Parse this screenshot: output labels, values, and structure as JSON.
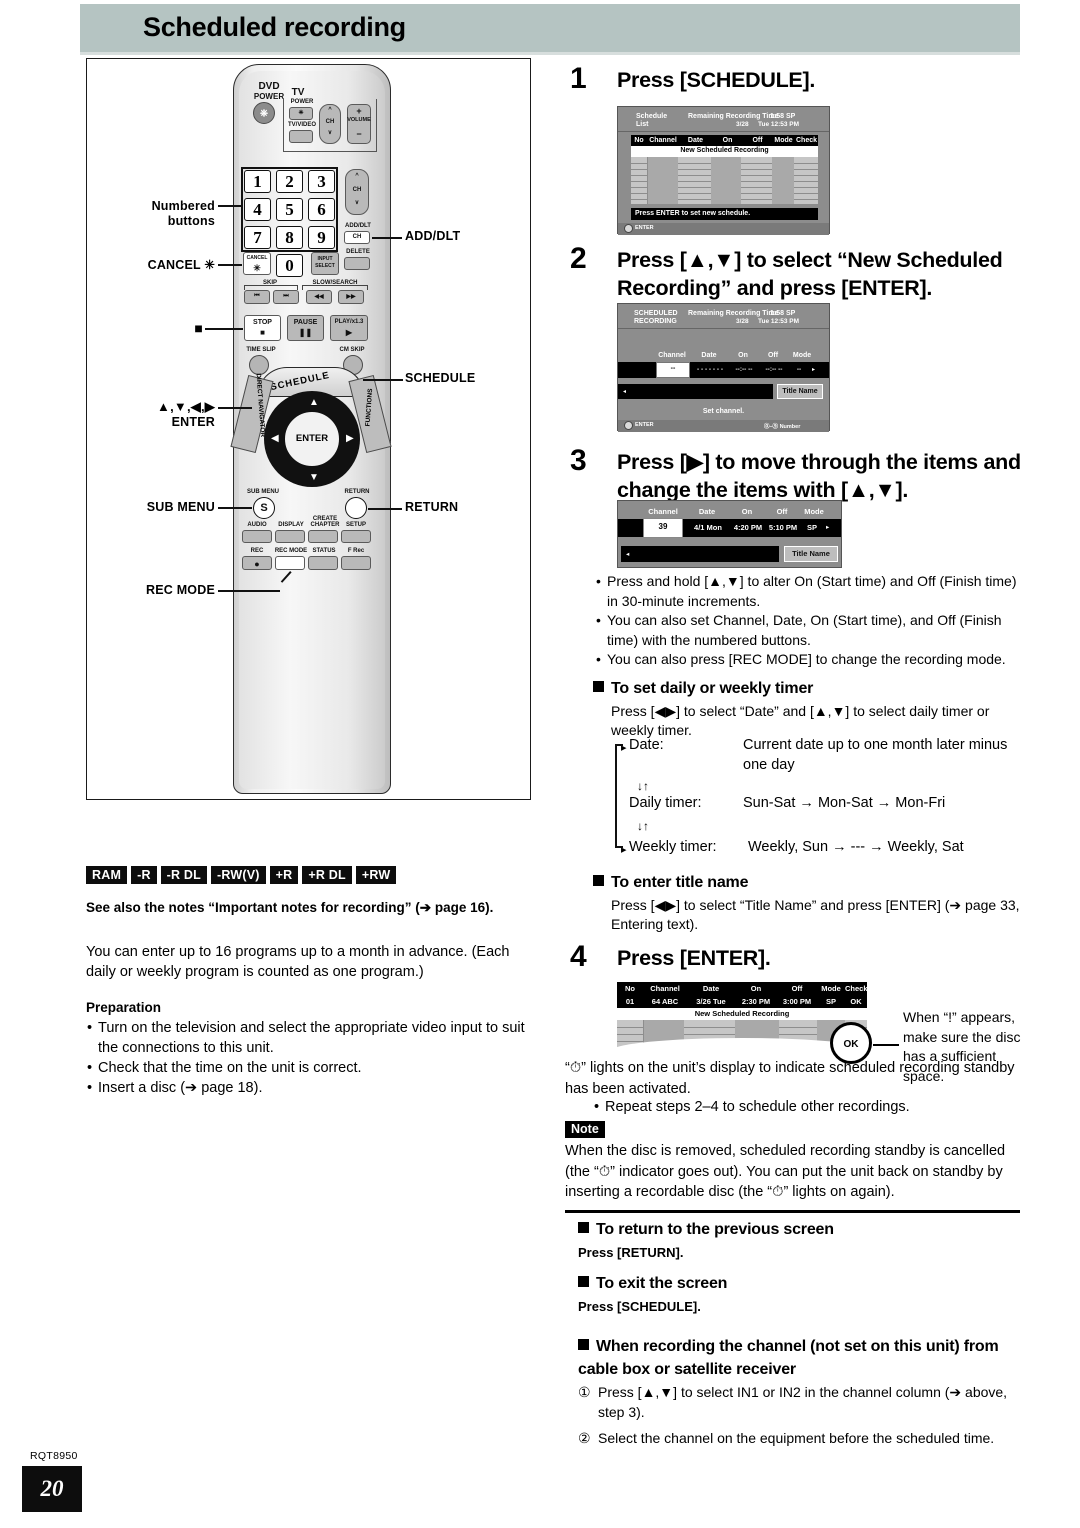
{
  "header": {
    "title": "Scheduled recording"
  },
  "remote": {
    "labels": {
      "numbered_buttons": "Numbered\nbuttons",
      "numbered_buttons_l1": "Numbered",
      "numbered_buttons_l2": "buttons",
      "cancel": "CANCEL ✳",
      "stop_square": "■",
      "arrows_enter_l1": "▲,▼,◀,▶",
      "arrows_enter_l2": "ENTER",
      "sub_menu": "SUB MENU",
      "rec_mode": "REC MODE",
      "add_dlt": "ADD/DLT",
      "schedule": "SCHEDULE",
      "return": "RETURN"
    },
    "buttons": {
      "dvd_power_l1": "DVD",
      "dvd_power_l2": "POWER",
      "tv": "TV",
      "tv_power": "POWER",
      "tv_video": "TV/VIDEO",
      "ch": "CH",
      "volume": "VOLUME",
      "vol_plus": "+",
      "vol_minus": "−",
      "add_dlt_small": "ADD/DLT",
      "ch_small": "CH",
      "delete": "DELETE",
      "cancel_small": "CANCEL",
      "cancel_star": "✳",
      "input_select_l1": "INPUT",
      "input_select_l2": "SELECT",
      "skip": "SKIP",
      "slow_search": "SLOW/SEARCH",
      "skip_back": "⏮",
      "skip_fwd": "⏭",
      "search_back": "◀◀",
      "search_fwd": "▶▶",
      "stop": "STOP",
      "pause": "PAUSE",
      "play": "PLAY/x1.3",
      "time_slip": "TIME SLIP",
      "cm_skip": "CM SKIP",
      "schedule_cap": "SCHEDULE",
      "direct_navigator": "DIRECT NAVIGATOR",
      "functions": "FUNCTIONS",
      "enter": "ENTER",
      "sub_menu_s": "S",
      "sub_menu_lbl": "SUB MENU",
      "return_lbl": "RETURN",
      "audio": "AUDIO",
      "display": "DISPLAY",
      "create_chapter_l1": "CREATE",
      "create_chapter_l2": "CHAPTER",
      "setup": "SETUP",
      "rec": "REC",
      "rec_mode": "REC MODE",
      "status": "STATUS",
      "f_rec": "F Rec",
      "keys": [
        "1",
        "2",
        "3",
        "4",
        "5",
        "6",
        "7",
        "8",
        "9",
        "0"
      ]
    }
  },
  "disc_badges": [
    "RAM",
    "-R",
    "-R DL",
    "-RW(V)",
    "+R",
    "+R DL",
    "+RW"
  ],
  "see_also": "See also the notes “Important notes for recording” (➔ page 16).",
  "intro": "You can enter up to 16 programs up to a month in advance. (Each daily or weekly program is counted as one program.)",
  "preparation": {
    "title": "Preparation",
    "items": [
      "Turn on the television and select the appropriate video input to suit the connections to this unit.",
      "Check that the time on the unit is correct.",
      "Insert a disc (➔ page 18)."
    ]
  },
  "steps": {
    "s1": {
      "num": "1",
      "text": "Press [SCHEDULE]."
    },
    "s2": {
      "num": "2",
      "text": "Press [▲,▼] to select “New Scheduled Recording” and press [ENTER]."
    },
    "s3": {
      "num": "3",
      "text": "Press [▶] to move through the items and change the items with [▲,▼]."
    },
    "s4": {
      "num": "4",
      "text": "Press [ENTER]."
    }
  },
  "osd1": {
    "title_l1": "Schedule",
    "title_l2": "List",
    "remaining": "Remaining Recording Time",
    "remaining_val": "1:58 SP",
    "datetime_date": "3/28",
    "datetime_time": "Tue 12:53 PM",
    "columns": [
      "No",
      "Channel",
      "Date",
      "On",
      "Off",
      "Mode",
      "Check"
    ],
    "new_row": "New Scheduled Recording",
    "message": "Press ENTER to set new schedule.",
    "enter_label": "ENTER"
  },
  "osd2": {
    "title_l1": "SCHEDULED",
    "title_l2": "RECORDING",
    "remaining": "Remaining Recording Time",
    "remaining_val": "1:58 SP",
    "datetime_date": "3/28",
    "datetime_time": "Tue 12:53 PM",
    "columns": [
      "Channel",
      "Date",
      "On",
      "Off",
      "Mode"
    ],
    "values": [
      "--",
      "- - - - - - -",
      "--:-- --",
      "--:-- --",
      "--"
    ],
    "arrow": "▸",
    "title_name_btn": "Title Name",
    "left_arrow": "◂",
    "message": "Set channel.",
    "enter_label": "ENTER",
    "number_label": "⓪–⑨  Number"
  },
  "osd3": {
    "columns": [
      "Channel",
      "Date",
      "On",
      "Off",
      "Mode"
    ],
    "values": [
      "39",
      "4/1 Mon",
      "4:20 PM",
      "5:10 PM",
      "SP"
    ],
    "arrow": "▸",
    "title_name_btn": "Title Name",
    "left_arrow": "◂"
  },
  "osd4": {
    "columns": [
      "No",
      "Channel",
      "Date",
      "On",
      "Off",
      "Mode",
      "Check"
    ],
    "row": [
      "01",
      "64 ABC",
      "3/26 Tue",
      "2:30 PM",
      "3:00 PM",
      "SP",
      "OK"
    ],
    "new_row": "New Scheduled Recording",
    "ok_badge": "OK",
    "callout_text": "When “!” appears, make sure the disc has a sufficient space."
  },
  "step3_bullets": [
    "Press and hold [▲,▼] to alter On (Start time) and Off (Finish time) in 30-minute increments.",
    "You can also set Channel, Date, On (Start time), and Off (Finish time) with the numbered buttons.",
    "You can also press [REC MODE] to change the recording mode."
  ],
  "daily_weekly": {
    "heading": "To set daily or weekly timer",
    "intro": "Press [◀▶] to select “Date” and [▲,▼] to select daily timer or weekly timer.",
    "rows": [
      {
        "label": "Date:",
        "value": "Current date up to one month later minus one day"
      },
      {
        "label": "Daily timer:",
        "value": "Sun-Sat → Mon-Sat → Mon-Fri"
      },
      {
        "label": "Weekly timer:",
        "value": "Weekly, Sun → --- → Weekly, Sat"
      }
    ],
    "updown": "↓↑"
  },
  "title_name": {
    "heading": "To enter title name",
    "body": "Press [◀▶] to select “Title Name” and press [ENTER] (➔ page 33, Entering text)."
  },
  "after_step4": {
    "line1": "“⏱” lights on the unit’s display to indicate scheduled recording standby has been activated.",
    "bullet": "Repeat steps 2–4 to schedule other recordings."
  },
  "note": {
    "tag": "Note",
    "body": "When the disc is removed, scheduled recording standby is cancelled (the “⏱” indicator goes out). You can put the unit back on standby by inserting a recordable disc (the “⏱” lights on again)."
  },
  "return_section": {
    "heading": "To return to the previous screen",
    "body": "Press [RETURN]."
  },
  "exit_section": {
    "heading": "To exit the screen",
    "body": "Press [SCHEDULE]."
  },
  "cable_section": {
    "heading": "When recording the channel (not set on this unit) from cable box or satellite receiver",
    "items": [
      {
        "marker": "①",
        "text": "Press [▲,▼] to select IN1 or IN2 in the channel column (➔ above, step 3)."
      },
      {
        "marker": "②",
        "text": "Select the channel on the equipment before the scheduled time."
      }
    ]
  },
  "footer": {
    "model": "RQT8950",
    "page": "20"
  }
}
